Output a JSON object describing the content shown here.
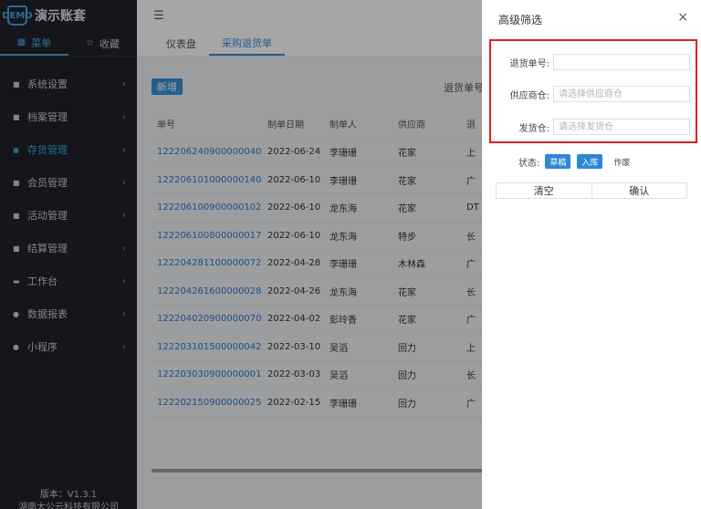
{
  "sidebar": {
    "brand_logo": "DEMO",
    "brand_name": "演示账套",
    "tabs": [
      {
        "icon": "grid-icon",
        "label": "菜单"
      },
      {
        "icon": "star-icon",
        "label": "收藏"
      }
    ],
    "menu": [
      {
        "label": "系统设置"
      },
      {
        "label": "档案管理"
      },
      {
        "label": "存货管理"
      },
      {
        "label": "会员管理"
      },
      {
        "label": "活动管理"
      },
      {
        "label": "结算管理"
      },
      {
        "label": "工作台"
      },
      {
        "label": "数据报表"
      },
      {
        "label": "小程序"
      }
    ],
    "version": "版本：V1.3.1",
    "company": "湖南太公云科技有限公司"
  },
  "topbar": {
    "menu_toggle_icon": "menu-fold-icon"
  },
  "tabs": [
    {
      "label": "仪表盘"
    },
    {
      "label": "采购退货单"
    }
  ],
  "toolbar": {
    "add_label": "新增",
    "filter_label": "退货单号"
  },
  "table": {
    "headers": [
      "单号",
      "制单日期",
      "制单人",
      "供应商",
      "退"
    ],
    "rows": [
      [
        "122206240900000040",
        "2022-06-24",
        "李珊珊",
        "花家",
        "上"
      ],
      [
        "122206101000000140",
        "2022-06-10",
        "李珊珊",
        "花家",
        "广"
      ],
      [
        "122206100900000102",
        "2022-06-10",
        "龙东海",
        "花家",
        "DT"
      ],
      [
        "122206100800000017",
        "2022-06-10",
        "龙东海",
        "特步",
        "长"
      ],
      [
        "122204281100000072",
        "2022-04-28",
        "李珊珊",
        "木林森",
        "广"
      ],
      [
        "122204261600000028",
        "2022-04-26",
        "龙东海",
        "花家",
        "长"
      ],
      [
        "122204020900000070",
        "2022-04-02",
        "彭玲香",
        "花家",
        "广"
      ],
      [
        "122203101500000042",
        "2022-03-10",
        "吴滔",
        "回力",
        "上"
      ],
      [
        "122203030900000001",
        "2022-03-03",
        "吴滔",
        "回力",
        "长"
      ],
      [
        "122202150900000025",
        "2022-02-15",
        "李珊珊",
        "回力",
        "广"
      ]
    ]
  },
  "drawer": {
    "title": "高级筛选",
    "close_glyph": "×",
    "fields": {
      "return_no": {
        "label": "退货单号:",
        "value": "",
        "placeholder": ""
      },
      "supplier_wh": {
        "label": "供应商仓:",
        "value": "",
        "placeholder": "请选择供应商仓"
      },
      "ship_wh": {
        "label": "发货仓:",
        "value": "",
        "placeholder": "请选择发货仓"
      }
    },
    "status_label": "状态:",
    "status_options": [
      {
        "label": "草稿",
        "selected": true
      },
      {
        "label": "入库",
        "selected": true
      },
      {
        "label": "作废",
        "selected": false
      }
    ],
    "clear_label": "清空",
    "confirm_label": "确认"
  },
  "colors": {
    "accent": "#3a8fd9",
    "sidebar_bg": "#20232a",
    "highlight": "#e02020"
  }
}
